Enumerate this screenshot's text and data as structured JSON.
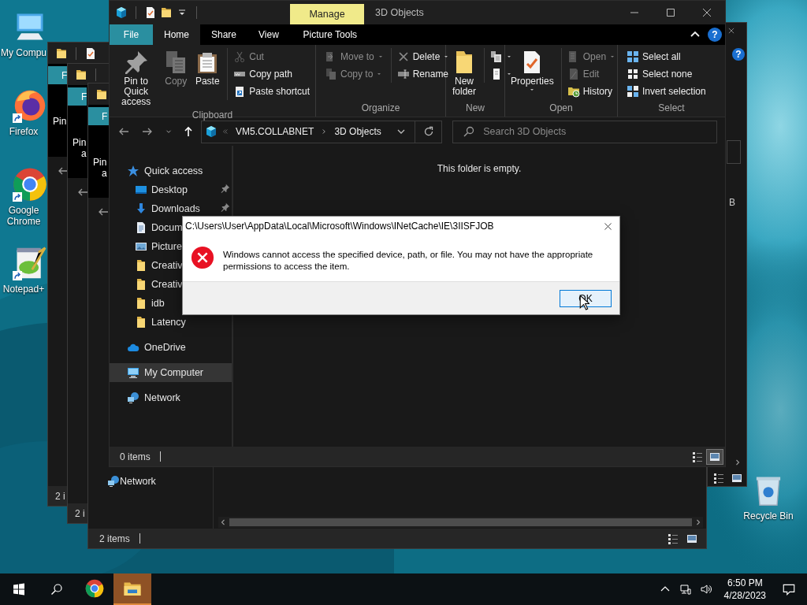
{
  "desktop": {
    "icons": [
      {
        "kind": "computer",
        "label": "My Compu",
        "shortcut": false
      },
      {
        "kind": "firefox",
        "label": "Firefox",
        "shortcut": true
      },
      {
        "kind": "chrome",
        "label": "Google Chrome",
        "shortcut": true
      },
      {
        "kind": "notepad",
        "label": "Notepad+",
        "shortcut": true
      }
    ],
    "recycle_bin": {
      "label": "Recycle Bin"
    }
  },
  "background_windows": [
    {
      "file_tab": "F",
      "ribbon_lines": [
        "Pin"
      ],
      "status": "2 i"
    },
    {
      "file_tab": "F",
      "ribbon_lines": [
        "Pin",
        "a"
      ],
      "status": "2 i"
    },
    {
      "file_tab": "F",
      "ribbon_lines": [
        "Pin",
        "a"
      ],
      "nav_item": "Network",
      "status": "2 items"
    }
  ],
  "right_window": {
    "help": "?",
    "size_text": "B"
  },
  "explorer": {
    "context_tab": "Manage",
    "title": "3D Objects",
    "tabs": [
      {
        "label": "File",
        "kind": "file",
        "selected": false
      },
      {
        "label": "Home",
        "kind": "tab",
        "selected": true
      },
      {
        "label": "Share",
        "kind": "tab",
        "selected": false
      },
      {
        "label": "View",
        "kind": "tab",
        "selected": false
      },
      {
        "label": "Picture Tools",
        "kind": "contextual",
        "selected": false
      }
    ],
    "help": "?",
    "ribbon": [
      {
        "name": "Clipboard",
        "items": [
          {
            "kind": "large",
            "label": "Pin to Quick access",
            "disabled": false,
            "menu": false
          },
          {
            "kind": "large",
            "label": "Copy",
            "disabled": true,
            "menu": false
          },
          {
            "kind": "large",
            "label": "Paste",
            "disabled": false,
            "menu": false
          },
          {
            "kind": "stack",
            "commands": [
              {
                "label": "Cut",
                "disabled": true,
                "menu": false
              },
              {
                "label": "Copy path",
                "disabled": false,
                "menu": false
              },
              {
                "label": "Paste shortcut",
                "disabled": false,
                "menu": false
              }
            ]
          }
        ]
      },
      {
        "name": "Organize",
        "items": [
          {
            "kind": "stack",
            "commands": [
              {
                "label": "Move to",
                "disabled": true,
                "menu": true
              },
              {
                "label": "Copy to",
                "disabled": true,
                "menu": true
              }
            ]
          },
          {
            "kind": "stack",
            "commands": [
              {
                "label": "Delete",
                "disabled": false,
                "menu": true
              },
              {
                "label": "Rename",
                "disabled": false,
                "menu": false
              }
            ]
          }
        ]
      },
      {
        "name": "New",
        "items": [
          {
            "kind": "large",
            "label": "New folder",
            "disabled": false,
            "menu": false
          },
          {
            "kind": "stack",
            "commands": [
              {
                "disabled": false,
                "menu": true
              },
              {
                "disabled": false,
                "menu": true
              }
            ]
          }
        ]
      },
      {
        "name": "Open",
        "items": [
          {
            "kind": "large",
            "label": "Properties",
            "disabled": false,
            "menu": true
          },
          {
            "kind": "stack",
            "commands": [
              {
                "label": "Open",
                "disabled": true,
                "menu": true
              },
              {
                "label": "Edit",
                "disabled": true,
                "menu": false
              },
              {
                "label": "History",
                "disabled": false,
                "menu": false
              }
            ]
          }
        ]
      },
      {
        "name": "Select",
        "items": [
          {
            "kind": "stack",
            "commands": [
              {
                "label": "Select all",
                "disabled": false,
                "menu": false
              },
              {
                "label": "Select none",
                "disabled": false,
                "menu": false
              },
              {
                "label": "Invert selection",
                "disabled": false,
                "menu": false
              }
            ]
          }
        ]
      }
    ],
    "address": {
      "location": "VM5.COLLABNET",
      "folder": "3D Objects"
    },
    "search": {
      "placeholder": "Search 3D Objects"
    },
    "nav": [
      {
        "label": "Quick access",
        "kind": "star",
        "selected": false,
        "children": [
          {
            "label": "Desktop",
            "kind": "desktop",
            "selected": false,
            "pinned": true
          },
          {
            "label": "Downloads",
            "kind": "download",
            "selected": false,
            "pinned": true
          },
          {
            "label": "Docum",
            "kind": "document",
            "selected": false,
            "pinned": false
          },
          {
            "label": "Picture",
            "kind": "picture",
            "selected": false,
            "pinned": false
          },
          {
            "label": "Creativ",
            "kind": "folder",
            "selected": false,
            "pinned": false
          },
          {
            "label": "Creativ",
            "kind": "folder",
            "selected": false,
            "pinned": false
          },
          {
            "label": "idb",
            "kind": "folder",
            "selected": false,
            "pinned": false
          },
          {
            "label": "Latency",
            "kind": "folder",
            "selected": false,
            "pinned": false
          }
        ]
      },
      {
        "label": "OneDrive",
        "kind": "cloud",
        "selected": false
      },
      {
        "label": "My Computer",
        "kind": "computer",
        "selected": true
      },
      {
        "label": "Network",
        "kind": "network",
        "selected": false
      }
    ],
    "empty_text": "This folder is empty.",
    "status": "0 items",
    "views": [
      {
        "kind": "details",
        "selected": false
      },
      {
        "kind": "thumbs",
        "selected": true
      }
    ]
  },
  "dialog": {
    "title": "C:\\Users\\User\\AppData\\Local\\Microsoft\\Windows\\INetCache\\IE\\3IISFJOB",
    "message": "Windows cannot access the specified device, path, or file. You may not have the appropriate permissions to access the item.",
    "button": "OK"
  },
  "taskbar": {
    "apps": [
      {
        "kind": "chrome",
        "active": false
      },
      {
        "kind": "explorer",
        "active": true
      }
    ],
    "time": "6:50 PM",
    "date": "4/28/2023"
  }
}
